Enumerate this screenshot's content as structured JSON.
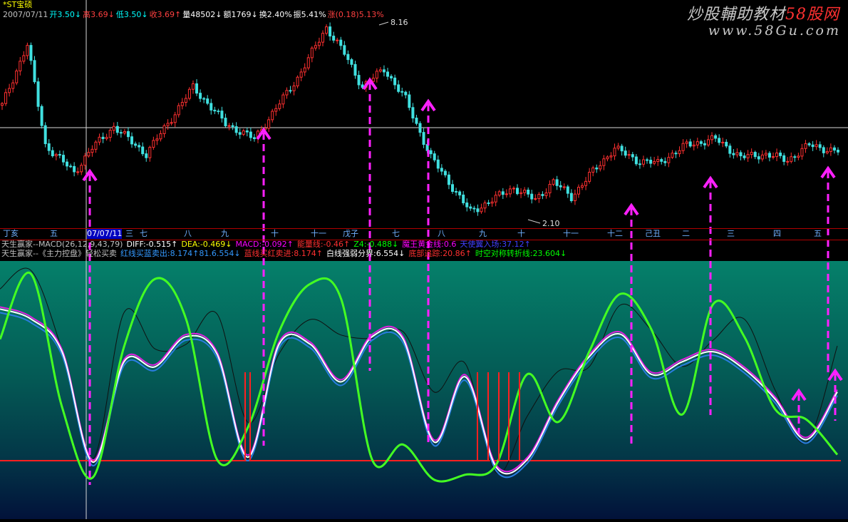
{
  "header": {
    "title": "*ST宝硕",
    "items": [
      {
        "text": "2007/07/11",
        "cls": "lbl"
      },
      {
        "text": "开3.50↓",
        "cls": "dn"
      },
      {
        "text": "高3.69↓",
        "cls": "up"
      },
      {
        "text": "低3.50↓",
        "cls": "dn"
      },
      {
        "text": "收3.69↑",
        "cls": "up"
      },
      {
        "text": "量48502↓",
        "cls": "wht"
      },
      {
        "text": "额1769↓",
        "cls": "wht"
      },
      {
        "text": "换2.40%",
        "cls": "wht"
      },
      {
        "text": "振5.41%",
        "cls": "wht"
      },
      {
        "text": "涨(0.18)5.13%",
        "cls": "up"
      }
    ]
  },
  "watermark": {
    "line1_a": "炒股輔助教材",
    "line1_b": "58股网",
    "line2": "www.58Gu.com"
  },
  "price_labels": {
    "high": "8.16",
    "low": "2.10"
  },
  "date_labels": [
    "丁亥",
    "五",
    "07/07/11",
    "三",
    "七",
    "八",
    "九",
    "十",
    "十一",
    "戊子",
    "七",
    "八",
    "九",
    "十",
    "十一",
    "十二",
    "己丑",
    "二",
    "三",
    "四",
    "五"
  ],
  "info1": [
    {
      "text": "天生赢家--MACD(26,12,9,43,79)",
      "color": "#c0c0c0"
    },
    {
      "text": "DIFF:-0.515↑",
      "color": "#ffffff"
    },
    {
      "text": "DEA:-0.469↓",
      "color": "#ffff00"
    },
    {
      "text": "MACD:-0.092↑",
      "color": "#ff00ff"
    },
    {
      "text": "能量线:-0.46↑",
      "color": "#ff3030"
    },
    {
      "text": "Z4:-0.488↓",
      "color": "#00ff00"
    },
    {
      "text": "魔王黄金线:0.6",
      "color": "#ff00ff"
    },
    {
      "text": "天使翼入场:37.12↑",
      "color": "#4040ff"
    }
  ],
  "info2": [
    {
      "text": "天生赢家--《主力控盘》轻松买卖",
      "color": "#c0c0c0"
    },
    {
      "text": "红线买蓝卖出:8.174↑81.6.554↓",
      "color": "#3399ff"
    },
    {
      "text": "蓝线买红卖进:8.174↑",
      "color": "#ff3030"
    },
    {
      "text": "白线强弱分界:6.554↓",
      "color": "#ffffff"
    },
    {
      "text": "底部追踪:20.86↑",
      "color": "#ff3030"
    },
    {
      "text": "时空对称转折线:23.604↓",
      "color": "#00ff00"
    }
  ],
  "chart_data": [
    {
      "type": "candlestick",
      "title": "*ST宝硕",
      "series_anchors": {
        "x_index": [
          0,
          7,
          12,
          20,
          25,
          31,
          40,
          53,
          62,
          70,
          82,
          90,
          95,
          100,
          106,
          112,
          119,
          130,
          142,
          148,
          153,
          158,
          163,
          170,
          176,
          182,
          190,
          198,
          205,
          212,
          218,
          224,
          231
        ],
        "price": [
          5.6,
          7.6,
          4.3,
          3.4,
          4.2,
          4.9,
          4.0,
          6.2,
          5.0,
          4.5,
          6.5,
          8.16,
          7.3,
          6.2,
          6.8,
          5.8,
          3.9,
          2.1,
          2.9,
          2.5,
          3.1,
          2.6,
          3.3,
          4.2,
          3.8,
          3.7,
          4.3,
          4.5,
          3.9,
          4.0,
          3.8,
          4.3,
          4.1
        ],
        "high": 8.16,
        "low": 2.1
      }
    },
    {
      "type": "line",
      "title": "天生赢家--《主力控盘》轻松买卖",
      "series": [
        {
          "name": "红线买蓝卖出",
          "values": [
            8.2,
            7.8,
            6.5,
            2.1,
            6.1,
            5.9,
            7.1,
            6.4,
            2.3,
            6.8,
            6.8,
            5.3,
            7.1,
            7.0,
            2.9,
            5.5,
            1.9,
            2.2,
            4.5,
            6.3,
            7.2,
            5.6,
            6.1,
            6.5,
            5.8,
            4.6,
            3.0,
            4.9
          ]
        },
        {
          "name": "时空对称转折线",
          "values": [
            7.0,
            9.6,
            4.3,
            1.5,
            6.7,
            9.4,
            7.8,
            2.2,
            3.5,
            7.3,
            9.2,
            8.6,
            2.2,
            2.8,
            1.4,
            1.6,
            2.0,
            5.6,
            3.7,
            6.5,
            8.8,
            7.4,
            4.0,
            8.4,
            7.1,
            4.2,
            3.8,
            2.4
          ]
        }
      ],
      "ylim": [
        0,
        10
      ]
    }
  ],
  "arrows": {
    "count": 9
  }
}
